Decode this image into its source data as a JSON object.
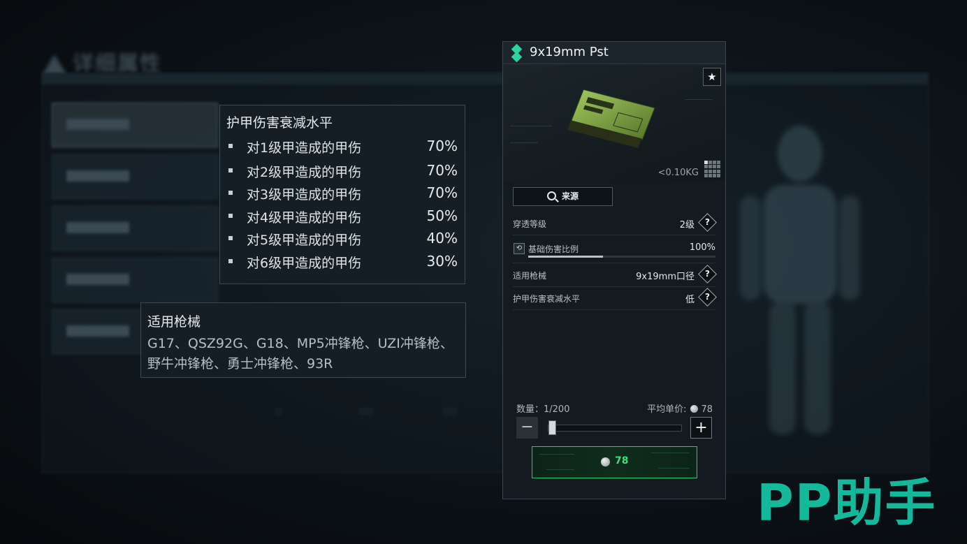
{
  "background": {
    "title": "详细属性"
  },
  "armor_tooltip": {
    "title": "护甲伤害衰减水平",
    "rows": [
      {
        "label": "对1级甲造成的甲伤",
        "value": "70%"
      },
      {
        "label": "对2级甲造成的甲伤",
        "value": "70%"
      },
      {
        "label": "对3级甲造成的甲伤",
        "value": "70%"
      },
      {
        "label": "对4级甲造成的甲伤",
        "value": "50%"
      },
      {
        "label": "对5级甲造成的甲伤",
        "value": "40%"
      },
      {
        "label": "对6级甲造成的甲伤",
        "value": "30%"
      }
    ]
  },
  "weapon_tooltip": {
    "title": "适用枪械",
    "body": "G17、QSZ92G、G18、MP5冲锋枪、UZI冲锋枪、野牛冲锋枪、勇士冲锋枪、93R"
  },
  "item": {
    "name": "9x19mm Pst",
    "weight": "<0.10KG",
    "favorite_icon": "star-icon",
    "source_button": "来源",
    "properties": {
      "penetration": {
        "label": "穿透等级",
        "value": "2级"
      },
      "base_damage": {
        "label": "基础伤害比例",
        "value": "100%",
        "fraction": 0.4
      },
      "weapons": {
        "label": "适用枪械",
        "value": "9x19mm口径"
      },
      "armor_damage": {
        "label": "护甲伤害衰减水平",
        "value": "低"
      }
    },
    "help_glyph": "?",
    "quantity_label": "数量：1/200",
    "quantity": 1,
    "quantity_max": 200,
    "avg_price_label": "平均单价:",
    "avg_price": "78",
    "buy_price": "78"
  },
  "colors": {
    "accent_green": "#2ec96b",
    "rarity_teal": "#2fd3a0",
    "watermark": "#14b89a"
  },
  "watermark": "PP助手"
}
